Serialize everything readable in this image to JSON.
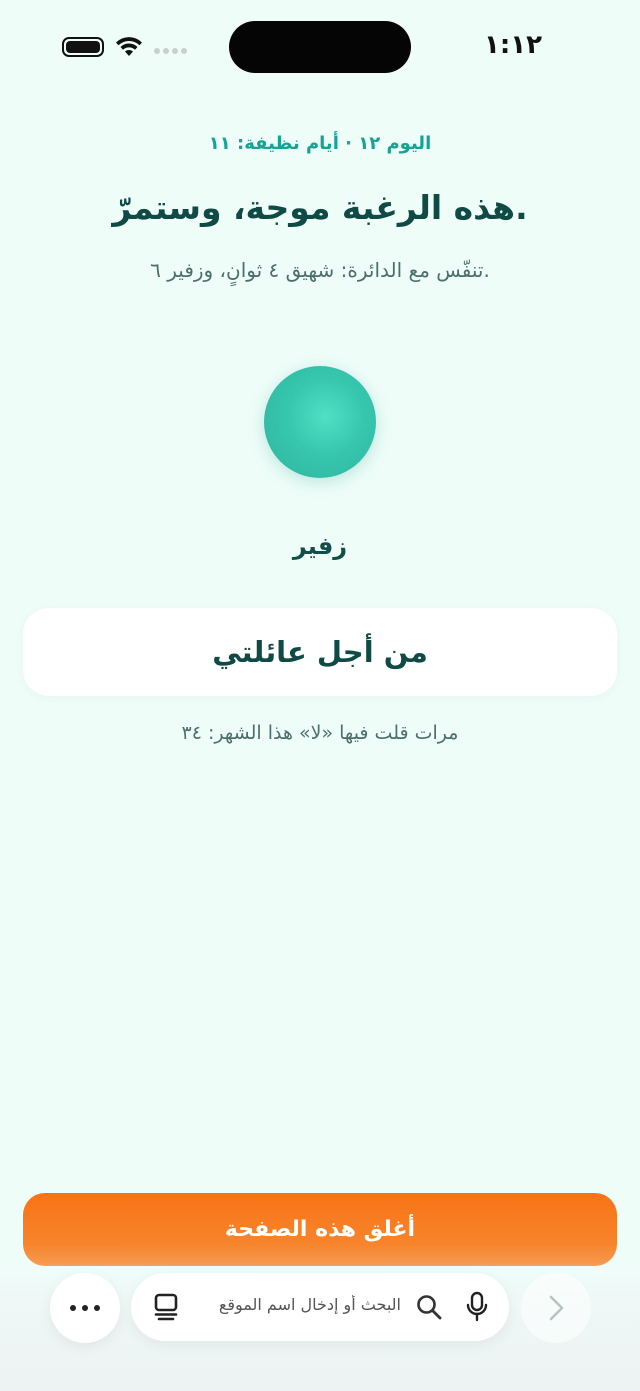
{
  "status_bar": {
    "time": "١:١٢"
  },
  "streak_text": "اليوم ١٢ · أيام نظيفة: ١١",
  "headline": "هذه الرغبة موجة، وستمرّ.",
  "instruction": "تنفّس مع الدائرة: شهيق ٤ ثوانٍ، وزفير ٦.",
  "breath_phase": "زفير",
  "reason": "من أجل عائلتي",
  "refusal_count_text": "مرات قلت فيها «لا» هذا الشهر: ٣٤",
  "close_button_label": "أغلق هذه الصفحة",
  "browser": {
    "address_placeholder": "البحث أو إدخال اسم الموقع",
    "icons": [
      "more-icon",
      "tabs-icon",
      "search-icon",
      "microphone-icon",
      "forward-chevron-icon"
    ]
  },
  "colors": {
    "background": "#effdf9",
    "accent_teal": "#16a394",
    "headline": "#0f4a45",
    "button_orange": "#f97316"
  }
}
